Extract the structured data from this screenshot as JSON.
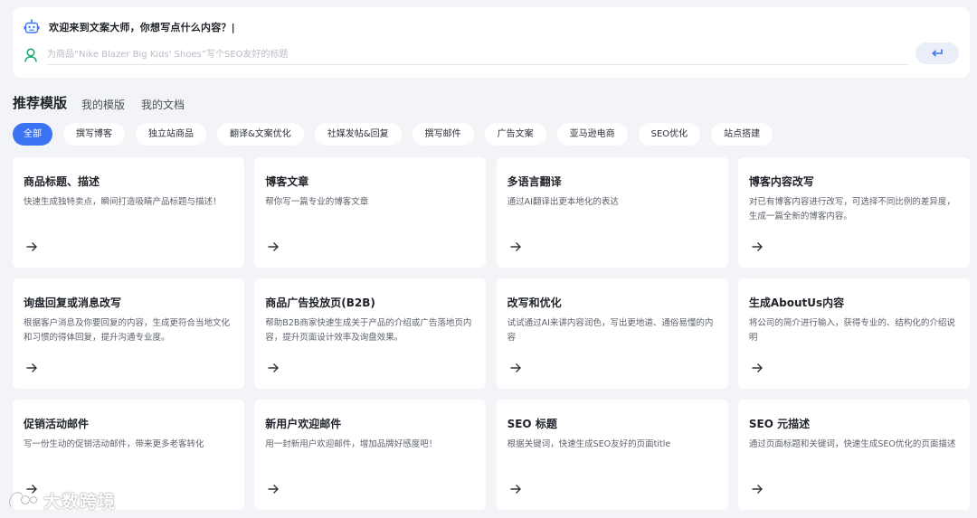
{
  "chat": {
    "greeting": "欢迎来到文案大师，你想写点什么内容？|",
    "input_placeholder": "为商品“Nike Blazer Big Kids' Shoes”写个SEO友好的标题",
    "send_icon": "enter-icon"
  },
  "tabs": [
    {
      "label": "推荐模版"
    },
    {
      "label": "我的模版"
    },
    {
      "label": "我的文档"
    }
  ],
  "filters": [
    {
      "label": "全部"
    },
    {
      "label": "撰写博客"
    },
    {
      "label": "独立站商品"
    },
    {
      "label": "翻译&文案优化"
    },
    {
      "label": "社媒发帖&回复"
    },
    {
      "label": "撰写邮件"
    },
    {
      "label": "广告文案"
    },
    {
      "label": "亚马逊电商"
    },
    {
      "label": "SEO优化"
    },
    {
      "label": "站点搭建"
    }
  ],
  "cards": [
    {
      "title": "商品标题、描述",
      "desc": "快速生成独特卖点，瞬间打造吸睛产品标题与描述！"
    },
    {
      "title": "博客文章",
      "desc": "帮你写一篇专业的博客文章"
    },
    {
      "title": "多语言翻译",
      "desc": "通过AI翻译出更本地化的表达"
    },
    {
      "title": "博客内容改写",
      "desc": "对已有博客内容进行改写，可选择不同比例的差异度，生成一篇全新的博客内容。"
    },
    {
      "title": "询盘回复或消息改写",
      "desc": "根据客户消息及你要回复的内容，生成更符合当地文化和习惯的得体回复，提升沟通专业度。"
    },
    {
      "title": "商品广告投放页(B2B)",
      "desc": "帮助B2B商家快速生成关于产品的介绍或广告落地页内容，提升页面设计效率及询盘效果。"
    },
    {
      "title": "改写和优化",
      "desc": "试试通过AI来讲内容润色，写出更地道、通俗易懂的内容"
    },
    {
      "title": "生成AboutUs内容",
      "desc": "将公司的简介进行输入，获得专业的、结构化的介绍说明"
    },
    {
      "title": "促销活动邮件",
      "desc": "写一份生动的促销活动邮件，带来更多老客转化"
    },
    {
      "title": "新用户欢迎邮件",
      "desc": "用一封新用户欢迎邮件，增加品牌好感度吧！"
    },
    {
      "title": "SEO 标题",
      "desc": "根据关键词，快速生成SEO友好的页面title"
    },
    {
      "title": "SEO 元描述",
      "desc": "通过页面标题和关键词，快速生成SEO优化的页面描述"
    }
  ],
  "watermark": {
    "text": "大数跨境"
  },
  "colors": {
    "accent": "#3b74f2",
    "background": "#f3f4f7",
    "card": "#ffffff"
  }
}
